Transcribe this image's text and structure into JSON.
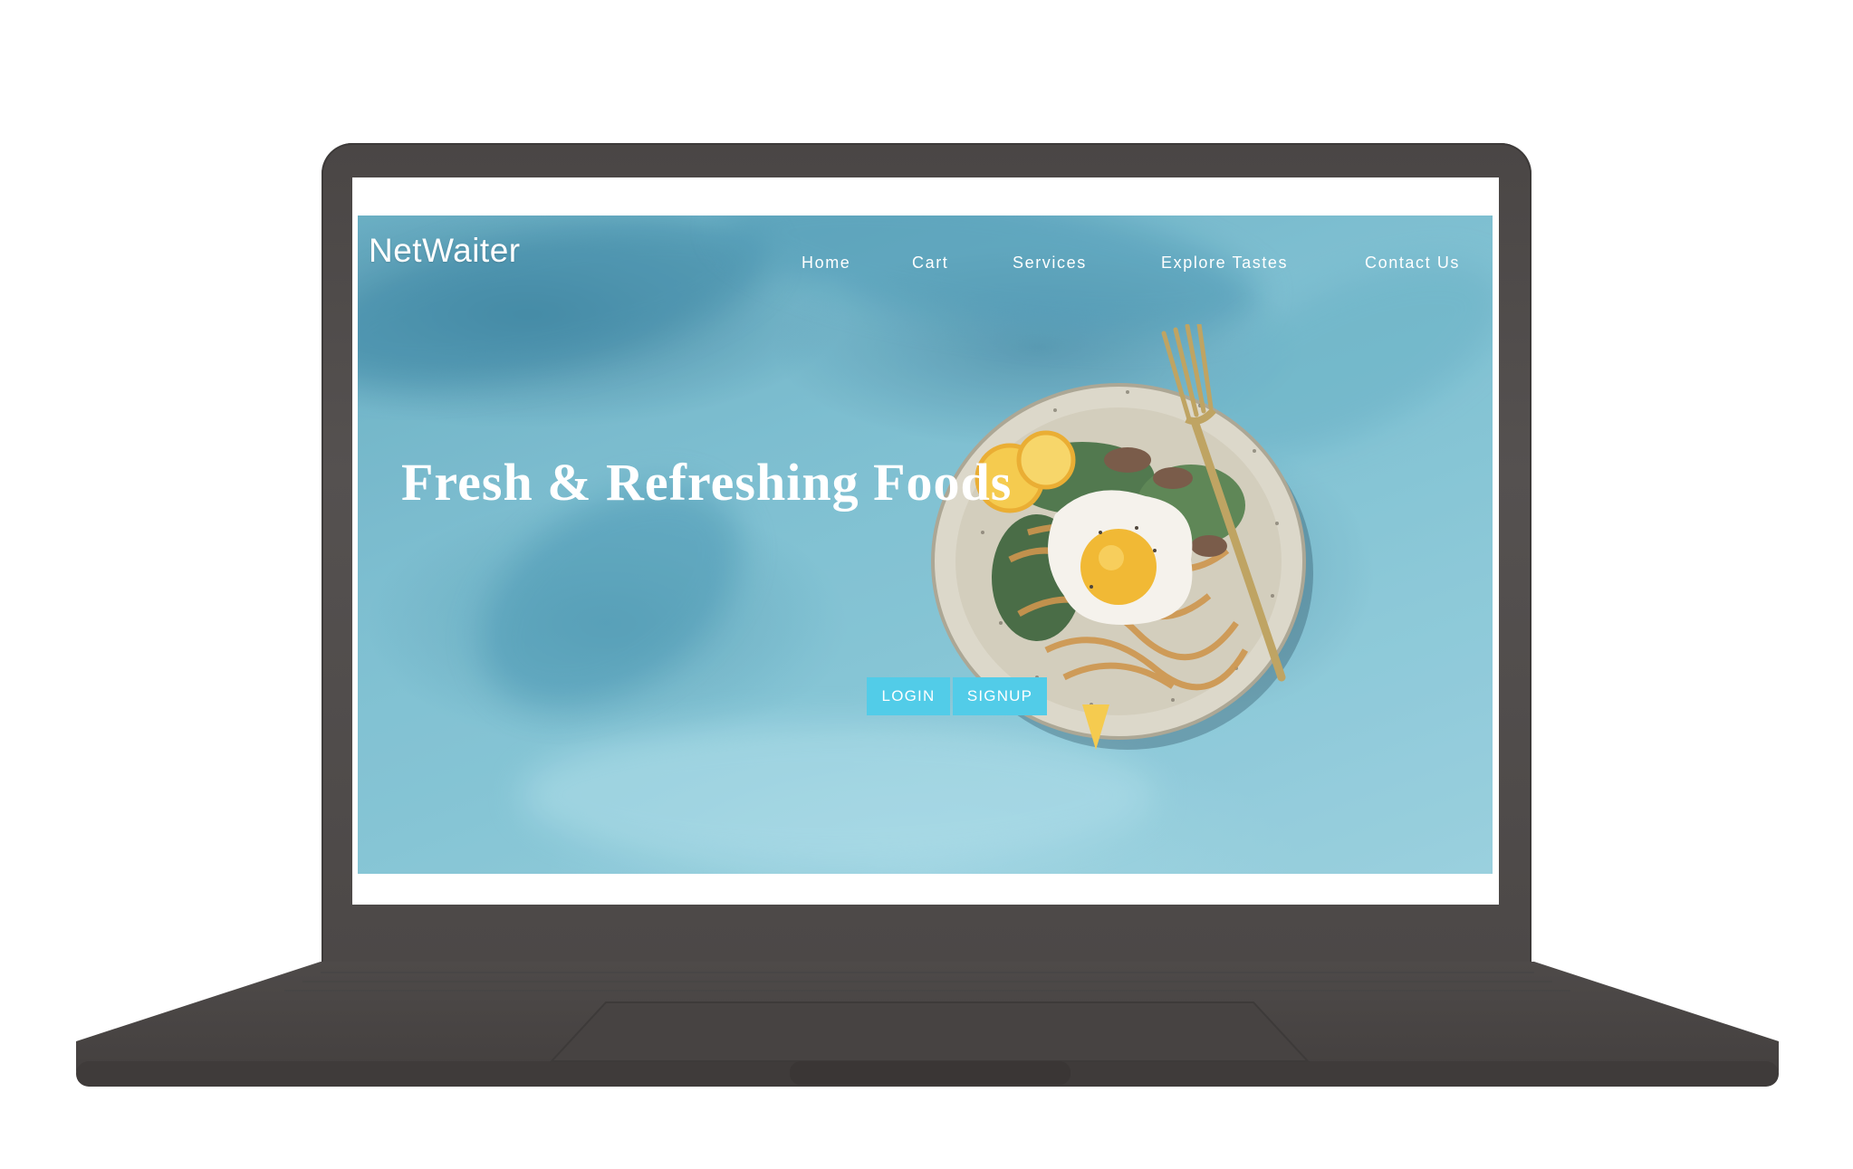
{
  "site": {
    "brand": "NetWaiter"
  },
  "nav": {
    "items": [
      {
        "label": "Home"
      },
      {
        "label": "Cart"
      },
      {
        "label": "Services"
      },
      {
        "label": "Explore Tastes"
      },
      {
        "label": "Contact Us"
      }
    ]
  },
  "hero": {
    "title": "Fresh & Refreshing Foods",
    "login_label": "LOGIN",
    "signup_label": "SIGNUP"
  },
  "colors": {
    "background_teal": "#6fb7cb",
    "button_accent": "#3fc7e6",
    "laptop_body": "#555150",
    "text": "#ffffff"
  },
  "icons": {
    "hero_image": "food-plate-illustration"
  }
}
